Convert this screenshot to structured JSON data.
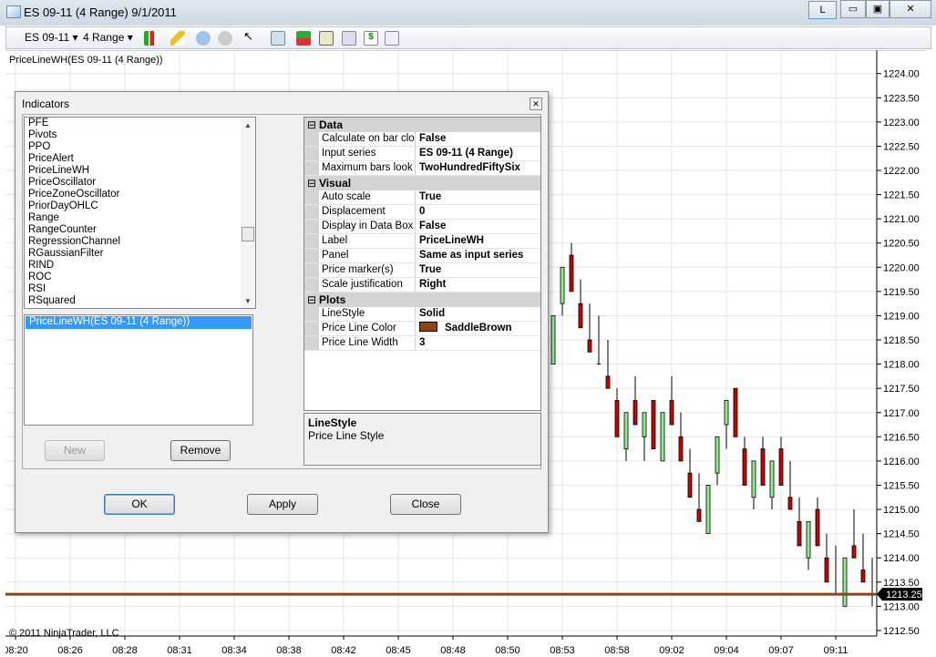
{
  "window": {
    "title": "ES 09-11 (4 Range)  9/1/2011",
    "btn_l": "L"
  },
  "toolbar": {
    "instrument": "ES 09-11",
    "period": "4 Range"
  },
  "chart": {
    "indicator_label": "PriceLineWH(ES 09-11 (4 Range))",
    "copyright": "© 2011 NinjaTrader, LLC",
    "price_marker": "1213.25",
    "price_line_color": "#8b4513"
  },
  "chart_data": {
    "type": "candlestick",
    "price_ticks": [
      "1224.00",
      "1223.50",
      "1223.00",
      "1222.50",
      "1222.00",
      "1221.50",
      "1221.00",
      "1220.50",
      "1220.00",
      "1219.50",
      "1219.00",
      "1218.50",
      "1218.00",
      "1217.50",
      "1217.00",
      "1216.50",
      "1216.00",
      "1215.50",
      "1215.00",
      "1214.50",
      "1214.00",
      "1213.50",
      "1213.00",
      "1212.50"
    ],
    "time_ticks": [
      "08:20",
      "08:26",
      "08:28",
      "08:31",
      "08:34",
      "08:38",
      "08:42",
      "08:45",
      "08:48",
      "08:50",
      "08:53",
      "08:58",
      "09:02",
      "09:04",
      "09:07",
      "09:11"
    ],
    "price_line": 1213.25,
    "ohlc": [
      [
        1218,
        1219,
        1218,
        1219
      ],
      [
        1219.25,
        1220,
        1219,
        1220
      ],
      [
        1220.25,
        1220.5,
        1219.5,
        1219.5
      ],
      [
        1219.25,
        1219.75,
        1218.75,
        1218.75
      ],
      [
        1218.5,
        1219.25,
        1218.25,
        1218.25
      ],
      [
        1218,
        1219,
        1218,
        1218
      ],
      [
        1217.75,
        1218.5,
        1217.5,
        1217.5
      ],
      [
        1217.25,
        1217.5,
        1216.5,
        1216.5
      ],
      [
        1216.25,
        1217,
        1216,
        1217
      ],
      [
        1217.25,
        1217.75,
        1216.75,
        1216.75
      ],
      [
        1216.5,
        1217,
        1216,
        1217
      ],
      [
        1217.25,
        1217.25,
        1216.25,
        1216.25
      ],
      [
        1216,
        1217,
        1216,
        1217
      ],
      [
        1217.25,
        1217.75,
        1216.75,
        1216.75
      ],
      [
        1216.5,
        1217,
        1216,
        1216
      ],
      [
        1215.75,
        1216.25,
        1215.25,
        1215.25
      ],
      [
        1215,
        1215.75,
        1214.75,
        1214.75
      ],
      [
        1214.5,
        1215.5,
        1214.5,
        1215.5
      ],
      [
        1215.75,
        1216.5,
        1215.5,
        1216.5
      ],
      [
        1216.75,
        1217.25,
        1216.25,
        1217.25
      ],
      [
        1217.5,
        1217.5,
        1216.5,
        1216.5
      ],
      [
        1216.25,
        1216.5,
        1215.5,
        1215.5
      ],
      [
        1215.25,
        1216,
        1215,
        1216
      ],
      [
        1216.25,
        1216.5,
        1215.5,
        1215.5
      ],
      [
        1215.25,
        1216,
        1215,
        1216
      ],
      [
        1216.25,
        1216.5,
        1215.5,
        1215.5
      ],
      [
        1215.25,
        1216,
        1215,
        1215
      ],
      [
        1214.75,
        1215.25,
        1214.25,
        1214.25
      ],
      [
        1214,
        1214.75,
        1213.75,
        1214.75
      ],
      [
        1215,
        1215.25,
        1214.25,
        1214.25
      ],
      [
        1214,
        1214.5,
        1213.5,
        1213.5
      ],
      [
        1213.25,
        1214.25,
        1213.25,
        1213.25
      ],
      [
        1213,
        1214,
        1213,
        1214
      ],
      [
        1214.25,
        1215,
        1214,
        1214
      ],
      [
        1213.75,
        1214.5,
        1213.5,
        1213.5
      ],
      [
        1213.25,
        1214,
        1213,
        1213.25
      ]
    ],
    "up_color": "#90ee90",
    "down_color": "#cc0000"
  },
  "dialog": {
    "title": "Indicators",
    "available": [
      "PFE",
      "Pivots",
      "PPO",
      "PriceAlert",
      "PriceLineWH",
      "PriceOscillator",
      "PriceZoneOscillator",
      "PriorDayOHLC",
      "Range",
      "RangeCounter",
      "RegressionChannel",
      "RGaussianFilter",
      "RIND",
      "ROC",
      "RSI",
      "RSquared"
    ],
    "applied": [
      "PriceLineWH(ES 09-11 (4 Range))"
    ],
    "new": "New",
    "remove": "Remove",
    "ok": "OK",
    "apply": "Apply",
    "close": "Close",
    "categories": [
      {
        "name": "Data",
        "rows": [
          [
            "Calculate on bar close",
            "False"
          ],
          [
            "Input series",
            "ES 09-11 (4 Range)"
          ],
          [
            "Maximum bars look back",
            "TwoHundredFiftySix"
          ]
        ]
      },
      {
        "name": "Visual",
        "rows": [
          [
            "Auto scale",
            "True"
          ],
          [
            "Displacement",
            "0"
          ],
          [
            "Display in Data Box",
            "False"
          ],
          [
            "Label",
            "PriceLineWH"
          ],
          [
            "Panel",
            "Same as input series"
          ],
          [
            "Price marker(s)",
            "True"
          ],
          [
            "Scale justification",
            "Right"
          ]
        ]
      },
      {
        "name": "Plots",
        "rows": [
          [
            "LineStyle",
            "Solid"
          ],
          [
            "Price Line Color",
            "SaddleBrown"
          ],
          [
            "Price Line Width",
            "3"
          ]
        ]
      }
    ],
    "swatch_color": "#8b4513",
    "desc_title": "LineStyle",
    "desc_text": "Price Line Style"
  }
}
